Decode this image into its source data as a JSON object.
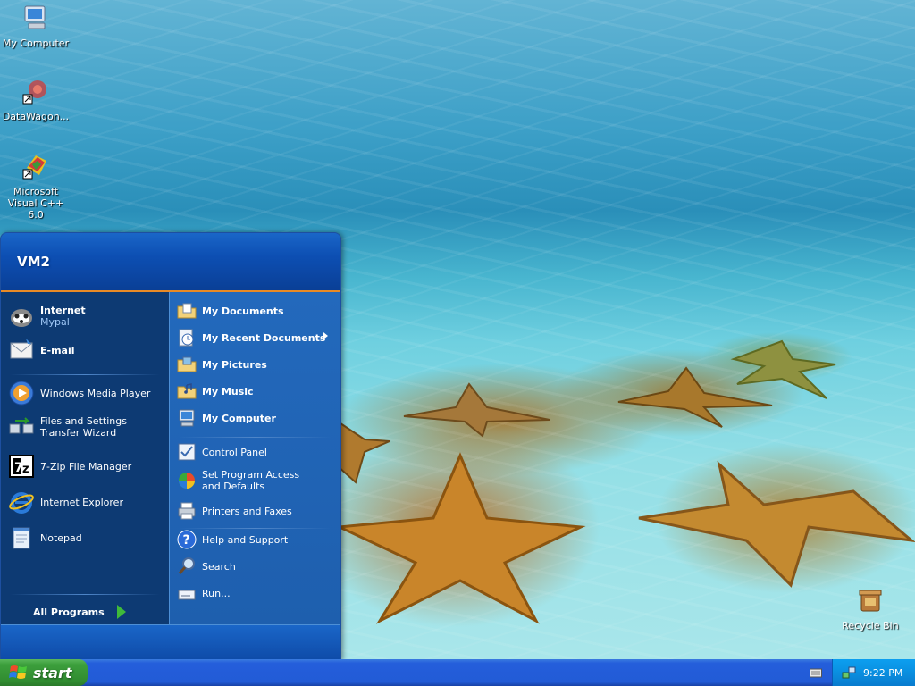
{
  "desktop": {
    "icons": [
      {
        "label": "My Computer",
        "icon": "my-computer-icon"
      },
      {
        "label": "DataWagon...",
        "icon": "datawagon-shortcut-icon"
      },
      {
        "label": "Microsoft Visual C++ 6.0",
        "icon": "visual-cpp-shortcut-icon"
      },
      {
        "label": "Recycle Bin",
        "icon": "recycle-bin-icon"
      }
    ]
  },
  "start_menu": {
    "user_name": "VM2",
    "pinned": [
      {
        "title": "Internet",
        "subtitle": "Mypal",
        "icon": "mypal-browser-icon"
      },
      {
        "title": "E-mail",
        "icon": "email-icon"
      }
    ],
    "recent_programs": [
      {
        "label": "Windows Media Player",
        "icon": "media-player-icon"
      },
      {
        "label": "Files and Settings Transfer Wizard",
        "icon": "transfer-wizard-icon"
      },
      {
        "label": "7-Zip File Manager",
        "icon": "seven-zip-icon"
      },
      {
        "label": "Internet Explorer",
        "icon": "internet-explorer-icon"
      },
      {
        "label": "Notepad",
        "icon": "notepad-icon"
      }
    ],
    "all_programs_label": "All Programs",
    "places": [
      {
        "label": "My Documents",
        "icon": "folder-documents-icon"
      },
      {
        "label": "My Recent Documents",
        "icon": "recent-documents-icon"
      },
      {
        "label": "My Pictures",
        "icon": "folder-pictures-icon"
      },
      {
        "label": "My Music",
        "icon": "folder-music-icon"
      },
      {
        "label": "My Computer",
        "icon": "computer-icon"
      }
    ],
    "settings": [
      {
        "label": "Control Panel",
        "icon": "control-panel-icon"
      },
      {
        "label": "Set Program Access and Defaults",
        "icon": "program-defaults-icon"
      },
      {
        "label": "Printers and Faxes",
        "icon": "printer-icon"
      }
    ],
    "help": [
      {
        "label": "Help and Support",
        "icon": "help-icon"
      },
      {
        "label": "Search",
        "icon": "search-icon"
      },
      {
        "label": "Run...",
        "icon": "run-icon"
      }
    ]
  },
  "taskbar": {
    "start_label": "start",
    "clock": "9:22 PM"
  },
  "colors": {
    "taskbar_blue": "#245edb",
    "start_green": "#3c9f3c",
    "menu_accent_orange": "#e88a26",
    "tray_blue": "#0a8fe0"
  }
}
